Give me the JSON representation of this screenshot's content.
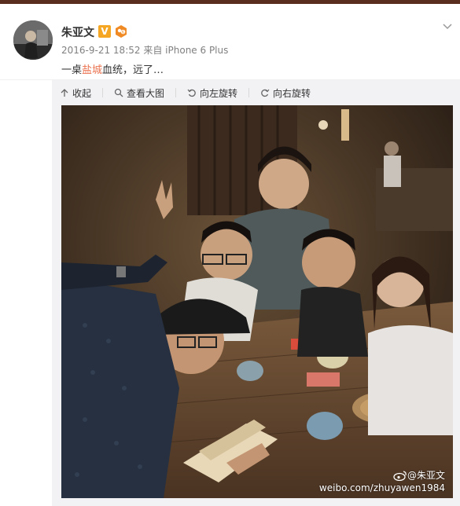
{
  "post": {
    "author": "朱亚文",
    "verified_badge": "V",
    "timestamp": "2016-9-21 18:52",
    "source_prefix": "来自",
    "source": "iPhone 6 Plus",
    "text_before": "一桌",
    "text_link": "盐城",
    "text_after": "血统，远了…"
  },
  "toolbar": {
    "collapse_label": "收起",
    "view_large_label": "查看大图",
    "rotate_left_label": "向左旋转",
    "rotate_right_label": "向右旋转"
  },
  "watermark": {
    "handle": "@朱亚文",
    "url": "weibo.com/zhuyawen1984"
  },
  "colors": {
    "link": "#eb7350",
    "badge": "#f5a623",
    "topbar": "#5a2e1e"
  },
  "icons": [
    "verified-v-icon",
    "level-badge-icon",
    "chevron-down-icon",
    "collapse-icon",
    "search-icon",
    "rotate-left-icon",
    "rotate-right-icon",
    "weibo-logo-icon"
  ]
}
